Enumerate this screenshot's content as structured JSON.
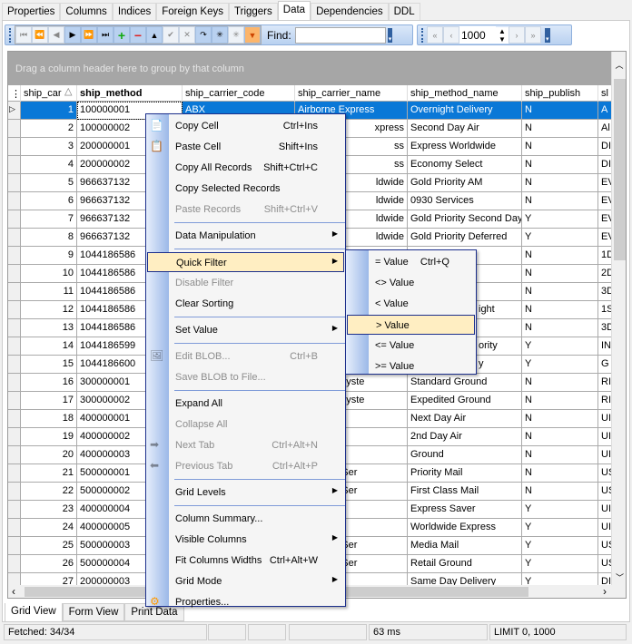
{
  "tabs": [
    "Properties",
    "Columns",
    "Indices",
    "Foreign Keys",
    "Triggers",
    "Data",
    "Dependencies",
    "DDL"
  ],
  "active_tab": "Data",
  "toolbar": {
    "find_label": "Find:",
    "find_value": "",
    "limit_value": "1000"
  },
  "group_panel": "Drag a column header here to group by that column",
  "columns": [
    "ship_car",
    "ship_method",
    "ship_carrier_code",
    "ship_carrier_name",
    "ship_method_name",
    "ship_publish",
    "sl"
  ],
  "rows": [
    [
      "1",
      "100000001",
      "ABX",
      "Airborne Express",
      "Overnight Delivery",
      "N",
      "A"
    ],
    [
      "2",
      "100000002",
      "",
      "xpress",
      "Second Day Air",
      "N",
      "Al"
    ],
    [
      "3",
      "200000001",
      "",
      "ss",
      "Express Worldwide",
      "N",
      "DI"
    ],
    [
      "4",
      "200000002",
      "",
      "ss",
      "Economy Select",
      "N",
      "DI"
    ],
    [
      "5",
      "966637132",
      "",
      "ldwide",
      "Gold Priority AM",
      "N",
      "EV"
    ],
    [
      "6",
      "966637132",
      "",
      "ldwide",
      "0930 Services",
      "N",
      "EV"
    ],
    [
      "7",
      "966637132",
      "",
      "ldwide",
      "Gold Priority Second Day",
      "Y",
      "EV"
    ],
    [
      "8",
      "966637132",
      "",
      "ldwide",
      "Gold Priority Deferred",
      "Y",
      "EV"
    ],
    [
      "9",
      "1044186586",
      "",
      "",
      "",
      "N",
      "1D"
    ],
    [
      "10",
      "1044186586",
      "",
      "",
      "",
      "N",
      "2D"
    ],
    [
      "11",
      "1044186586",
      "",
      "",
      "",
      "N",
      "3D"
    ],
    [
      "12",
      "1044186586",
      "",
      "",
      "ight",
      "N",
      "1S"
    ],
    [
      "13",
      "1044186586",
      "",
      "",
      "",
      "N",
      "3D"
    ],
    [
      "14",
      "1044186599",
      "",
      "",
      "ority",
      "Y",
      "IN"
    ],
    [
      "15",
      "1044186600",
      "",
      "",
      "y",
      "Y",
      "G"
    ],
    [
      "16",
      "300000001",
      "",
      "Package Syste",
      "Standard Ground",
      "N",
      "RI"
    ],
    [
      "17",
      "300000002",
      "",
      "Package Syste",
      "Expedited Ground",
      "N",
      "RI"
    ],
    [
      "18",
      "400000001",
      "",
      "el Service",
      "Next Day Air",
      "N",
      "UI"
    ],
    [
      "19",
      "400000002",
      "",
      "el Service",
      "2nd Day Air",
      "N",
      "UI"
    ],
    [
      "20",
      "400000003",
      "",
      "el Service",
      "Ground",
      "N",
      "UI"
    ],
    [
      "21",
      "500000001",
      "",
      "es Postal Ser",
      "Priority Mail",
      "N",
      "US"
    ],
    [
      "22",
      "500000002",
      "",
      "es Postal Ser",
      "First Class Mail",
      "N",
      "US"
    ],
    [
      "23",
      "400000004",
      "",
      "el Service",
      "Express Saver",
      "Y",
      "UI"
    ],
    [
      "24",
      "400000005",
      "",
      "el Service",
      "Worldwide Express",
      "Y",
      "UI"
    ],
    [
      "25",
      "500000003",
      "",
      "es Postal Ser",
      "Media Mail",
      "Y",
      "US"
    ],
    [
      "26",
      "500000004",
      "",
      "es Postal Ser",
      "Retail Ground",
      "Y",
      "US"
    ],
    [
      "27",
      "200000003",
      "",
      "ss",
      "Same Day Delivery",
      "Y",
      "DI"
    ]
  ],
  "context_menu": [
    {
      "label": "Copy Cell",
      "shortcut": "Ctrl+Ins",
      "icon": "copy-icon"
    },
    {
      "label": "Paste Cell",
      "shortcut": "Shift+Ins",
      "icon": "paste-icon"
    },
    {
      "label": "Copy All Records",
      "shortcut": "Shift+Ctrl+C"
    },
    {
      "label": "Copy Selected Records",
      "shortcut": ""
    },
    {
      "label": "Paste Records",
      "shortcut": "Shift+Ctrl+V",
      "disabled": true
    },
    {
      "sep": true
    },
    {
      "label": "Data Manipulation",
      "submenu": true
    },
    {
      "sep": true
    },
    {
      "label": "Quick Filter",
      "submenu": true,
      "highlight": true
    },
    {
      "label": "Disable Filter",
      "disabled": true
    },
    {
      "label": "Clear Sorting"
    },
    {
      "sep": true
    },
    {
      "label": "Set Value",
      "submenu": true
    },
    {
      "sep": true
    },
    {
      "label": "Edit BLOB...",
      "shortcut": "Ctrl+B",
      "disabled": true,
      "icon": "image-icon"
    },
    {
      "label": "Save BLOB to File...",
      "disabled": true
    },
    {
      "sep": true
    },
    {
      "label": "Expand All"
    },
    {
      "label": "Collapse All",
      "disabled": true
    },
    {
      "label": "Next Tab",
      "shortcut": "Ctrl+Alt+N",
      "disabled": true,
      "icon": "arrow-right-icon"
    },
    {
      "label": "Previous Tab",
      "shortcut": "Ctrl+Alt+P",
      "disabled": true,
      "icon": "arrow-left-icon"
    },
    {
      "sep": true
    },
    {
      "label": "Grid Levels",
      "submenu": true
    },
    {
      "sep": true
    },
    {
      "label": "Column Summary..."
    },
    {
      "label": "Visible Columns",
      "submenu": true
    },
    {
      "label": "Fit Columns Widths",
      "shortcut": "Ctrl+Alt+W"
    },
    {
      "label": "Grid Mode",
      "submenu": true
    },
    {
      "label": "Properties...",
      "icon": "gear-icon"
    }
  ],
  "quick_filter_menu": [
    {
      "label": "= Value",
      "shortcut": "Ctrl+Q"
    },
    {
      "label": "<> Value"
    },
    {
      "label": "< Value"
    },
    {
      "label": "> Value",
      "highlight": true
    },
    {
      "label": "<= Value"
    },
    {
      "label": ">= Value"
    }
  ],
  "bottom_tabs": [
    "Grid View",
    "Form View",
    "Print Data"
  ],
  "status": {
    "fetched": "Fetched: 34/34",
    "time": "63 ms",
    "limit": "LIMIT 0, 1000"
  },
  "colors": {
    "selection": "#0a78d7",
    "menu_highlight": "#ffeec2",
    "menu_border": "#1c2f8c"
  }
}
